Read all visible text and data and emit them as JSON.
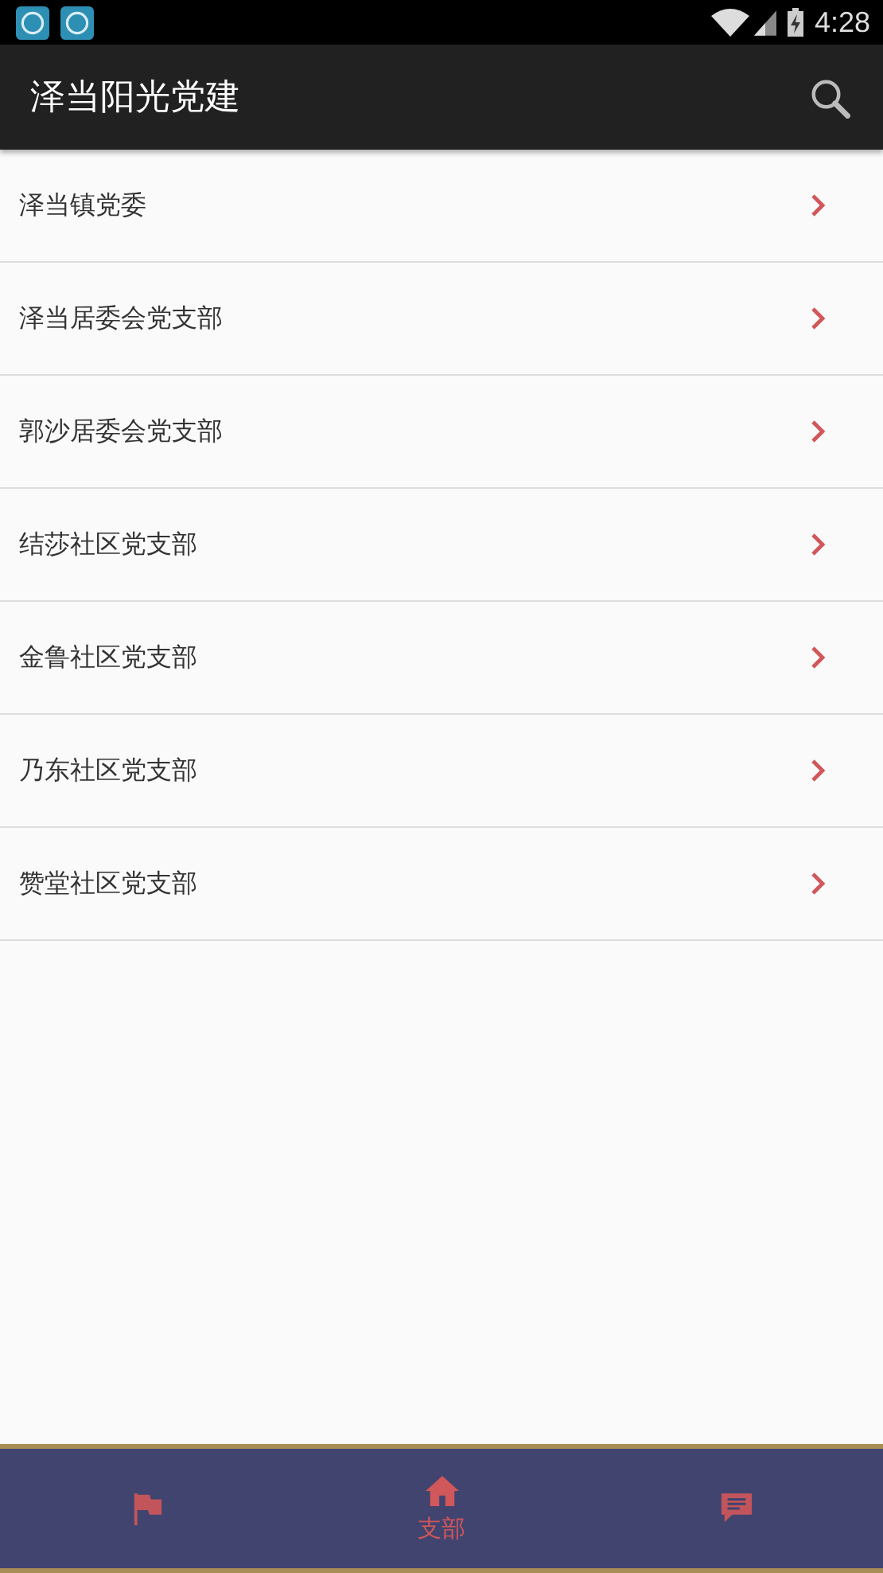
{
  "status_bar": {
    "time": "4:28"
  },
  "toolbar": {
    "title": "泽当阳光党建"
  },
  "list": [
    {
      "label": "泽当镇党委"
    },
    {
      "label": "泽当居委会党支部"
    },
    {
      "label": "郭沙居委会党支部"
    },
    {
      "label": "结莎社区党支部"
    },
    {
      "label": "金鲁社区党支部"
    },
    {
      "label": "乃东社区党支部"
    },
    {
      "label": "赞堂社区党支部"
    }
  ],
  "bottom_nav": [
    {
      "kind": "flag",
      "selected": false
    },
    {
      "kind": "home",
      "label": "支部",
      "selected": true
    },
    {
      "kind": "chat",
      "selected": false
    }
  ]
}
